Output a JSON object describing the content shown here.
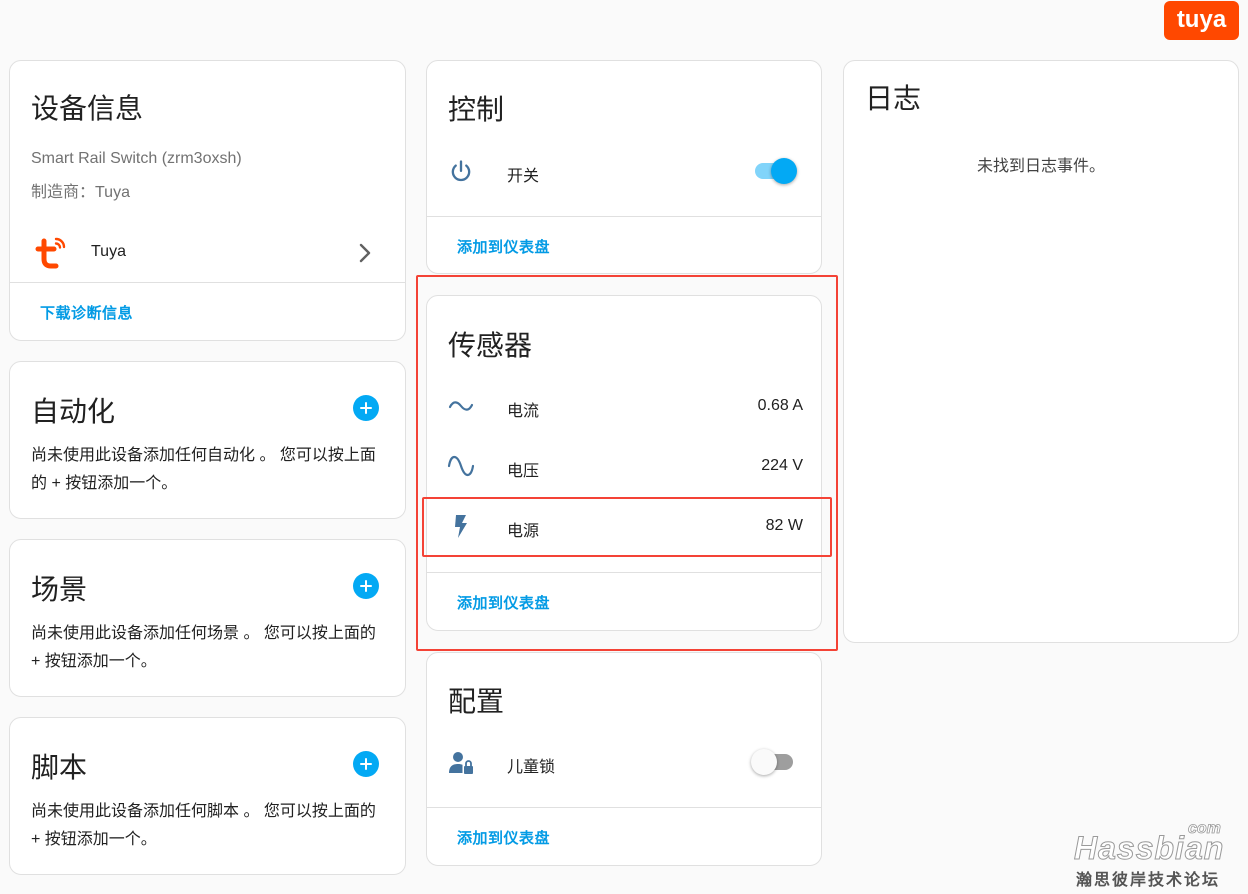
{
  "brand": {
    "logo_text": "tuya"
  },
  "device_info": {
    "title": "设备信息",
    "model": "Smart Rail Switch (zrm3oxsh)",
    "manufacturer": "制造商：Tuya",
    "integration_name": "Tuya",
    "download_link": "下载诊断信息"
  },
  "automation": {
    "title": "自动化",
    "description": "尚未使用此设备添加任何自动化 。 您可以按上面的 + 按钮添加一个。"
  },
  "scene": {
    "title": "场景",
    "description": "尚未使用此设备添加任何场景 。 您可以按上面的 + 按钮添加一个。"
  },
  "script": {
    "title": "脚本",
    "description": "尚未使用此设备添加任何脚本 。 您可以按上面的 + 按钮添加一个。"
  },
  "control": {
    "title": "控制",
    "switch_label": "开关",
    "switch_on": true,
    "add_link": "添加到仪表盘"
  },
  "sensors": {
    "title": "传感器",
    "rows": [
      {
        "label": "电流",
        "value": "0.68 A",
        "icon": "current-ac-icon"
      },
      {
        "label": "电压",
        "value": "224 V",
        "icon": "sine-wave-icon"
      },
      {
        "label": "电源",
        "value": "82 W",
        "icon": "lightning-bolt-icon"
      }
    ],
    "add_link": "添加到仪表盘"
  },
  "config": {
    "title": "配置",
    "child_lock_label": "儿童锁",
    "child_lock_on": false,
    "add_link": "添加到仪表盘"
  },
  "logbook": {
    "title": "日志",
    "empty_text": "未找到日志事件。"
  },
  "watermark": {
    "main": "Hassbian",
    "com": "com",
    "sub": "瀚思彼岸技术论坛"
  },
  "colors": {
    "accent": "#03a9f4",
    "link": "#039be5",
    "highlight": "#f44336",
    "tuya": "#ff4800",
    "icon": "#44739e"
  }
}
